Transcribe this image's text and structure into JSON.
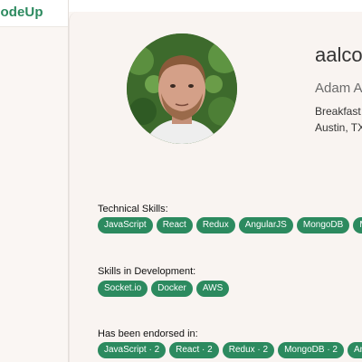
{
  "app": {
    "brand": "codeUp"
  },
  "profile": {
    "username": "aalcott",
    "full_name": "Adam Alc",
    "bio": "Breakfast c",
    "location": "Austin, TX"
  },
  "technical_skills": {
    "title": "Technical Skills:",
    "items": [
      "JavaScript",
      "React",
      "Redux",
      "AngularJS",
      "MongoDB",
      "MySQL"
    ]
  },
  "skills_in_development": {
    "title": "Skills in Development:",
    "items": [
      "Socket.io",
      "Docker",
      "AWS"
    ]
  },
  "endorsed_in": {
    "title": "Has been endorsed in:",
    "items": [
      "JavaScript · 2",
      "React · 2",
      "Redux · 2",
      "MongoDB · 2",
      "AngularJ"
    ]
  },
  "colors": {
    "brand_green": "#2c8a5f",
    "background": "#f9f4f1"
  }
}
